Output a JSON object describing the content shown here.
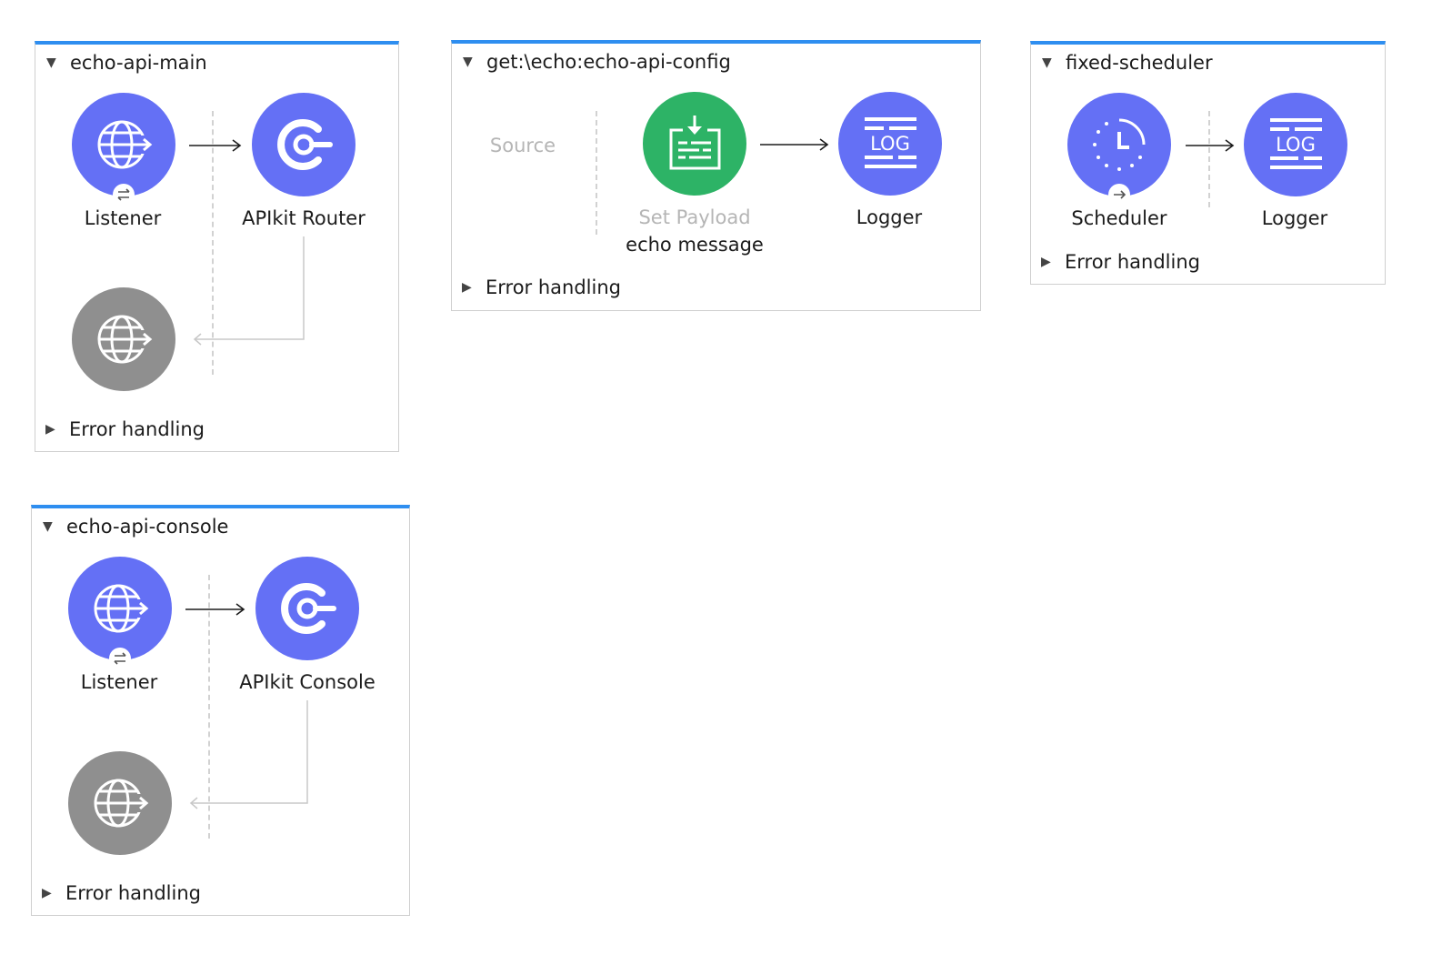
{
  "colors": {
    "flow_accent": "#2e8ef0",
    "node_blue": "#6470f5",
    "node_green": "#2db366",
    "node_gray": "#8f8f8f",
    "muted_text": "#b5b5b5"
  },
  "flows": [
    {
      "name": "echo-api-main",
      "nodes": [
        {
          "label": "Listener",
          "icon": "http-listener-icon",
          "badge": "bidirectional-arrows-icon"
        },
        {
          "label": "APIkit Router",
          "icon": "apikit-icon"
        },
        {
          "label": "",
          "icon": "http-response-icon"
        }
      ],
      "error_handling": "Error handling"
    },
    {
      "name": "get:\\echo:echo-api-config",
      "source_placeholder": "Source",
      "nodes": [
        {
          "label": "Set Payload",
          "sublabel": "echo message",
          "icon": "set-payload-icon"
        },
        {
          "label": "Logger",
          "icon": "log-icon",
          "icon_text": "LOG"
        }
      ],
      "error_handling": "Error handling"
    },
    {
      "name": "fixed-scheduler",
      "nodes": [
        {
          "label": "Scheduler",
          "icon": "clock-icon",
          "badge": "right-arrow-icon"
        },
        {
          "label": "Logger",
          "icon": "log-icon",
          "icon_text": "LOG"
        }
      ],
      "error_handling": "Error handling"
    },
    {
      "name": "echo-api-console",
      "nodes": [
        {
          "label": "Listener",
          "icon": "http-listener-icon",
          "badge": "bidirectional-arrows-icon"
        },
        {
          "label": "APIkit Console",
          "icon": "apikit-icon"
        },
        {
          "label": "",
          "icon": "http-response-icon"
        }
      ],
      "error_handling": "Error handling"
    }
  ]
}
